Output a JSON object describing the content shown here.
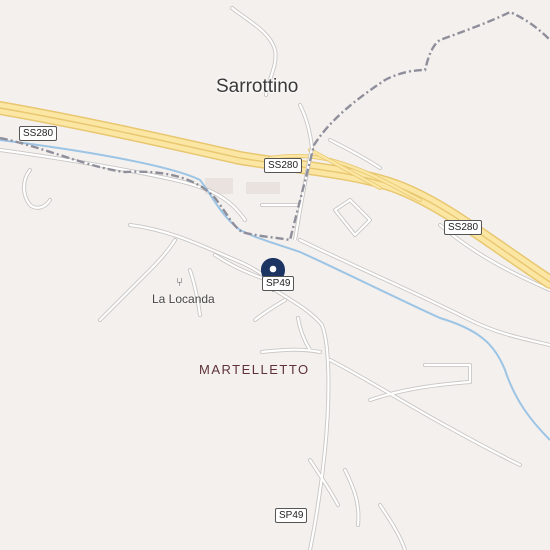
{
  "map": {
    "places": {
      "town": "Sarrottino",
      "locality": "MARTELLETTO",
      "restaurant": "La Locanda"
    },
    "route_shields": {
      "ss280_west": "SS280",
      "ss280_center": "SS280",
      "ss280_east": "SS280",
      "sp49_pin": "SP49",
      "sp49_south": "SP49"
    },
    "icons": {
      "restaurant": "fork-knife-icon",
      "marker": "location-pin-icon"
    },
    "colors": {
      "background": "#f4f0ee",
      "highway_fill": "#fbe6a3",
      "highway_casing": "#e8c770",
      "minor_road": "#ffffff",
      "road_edge": "#c9c6c4",
      "river": "#9cc4e4",
      "boundary": "#8f8f9c",
      "building": "#e9e2de",
      "pin": "#1c3461"
    }
  }
}
